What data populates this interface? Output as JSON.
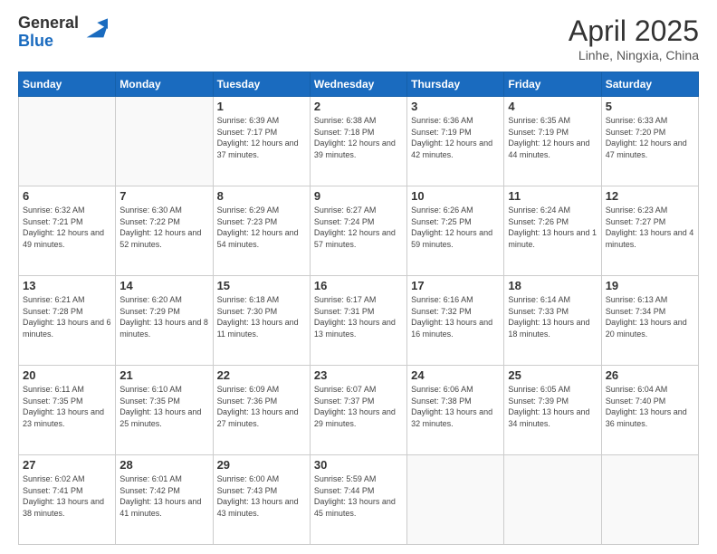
{
  "logo": {
    "general": "General",
    "blue": "Blue"
  },
  "title": "April 2025",
  "subtitle": "Linhe, Ningxia, China",
  "days_of_week": [
    "Sunday",
    "Monday",
    "Tuesday",
    "Wednesday",
    "Thursday",
    "Friday",
    "Saturday"
  ],
  "weeks": [
    [
      {
        "day": null
      },
      {
        "day": null
      },
      {
        "day": "1",
        "sunrise": "Sunrise: 6:39 AM",
        "sunset": "Sunset: 7:17 PM",
        "daylight": "Daylight: 12 hours and 37 minutes."
      },
      {
        "day": "2",
        "sunrise": "Sunrise: 6:38 AM",
        "sunset": "Sunset: 7:18 PM",
        "daylight": "Daylight: 12 hours and 39 minutes."
      },
      {
        "day": "3",
        "sunrise": "Sunrise: 6:36 AM",
        "sunset": "Sunset: 7:19 PM",
        "daylight": "Daylight: 12 hours and 42 minutes."
      },
      {
        "day": "4",
        "sunrise": "Sunrise: 6:35 AM",
        "sunset": "Sunset: 7:19 PM",
        "daylight": "Daylight: 12 hours and 44 minutes."
      },
      {
        "day": "5",
        "sunrise": "Sunrise: 6:33 AM",
        "sunset": "Sunset: 7:20 PM",
        "daylight": "Daylight: 12 hours and 47 minutes."
      }
    ],
    [
      {
        "day": "6",
        "sunrise": "Sunrise: 6:32 AM",
        "sunset": "Sunset: 7:21 PM",
        "daylight": "Daylight: 12 hours and 49 minutes."
      },
      {
        "day": "7",
        "sunrise": "Sunrise: 6:30 AM",
        "sunset": "Sunset: 7:22 PM",
        "daylight": "Daylight: 12 hours and 52 minutes."
      },
      {
        "day": "8",
        "sunrise": "Sunrise: 6:29 AM",
        "sunset": "Sunset: 7:23 PM",
        "daylight": "Daylight: 12 hours and 54 minutes."
      },
      {
        "day": "9",
        "sunrise": "Sunrise: 6:27 AM",
        "sunset": "Sunset: 7:24 PM",
        "daylight": "Daylight: 12 hours and 57 minutes."
      },
      {
        "day": "10",
        "sunrise": "Sunrise: 6:26 AM",
        "sunset": "Sunset: 7:25 PM",
        "daylight": "Daylight: 12 hours and 59 minutes."
      },
      {
        "day": "11",
        "sunrise": "Sunrise: 6:24 AM",
        "sunset": "Sunset: 7:26 PM",
        "daylight": "Daylight: 13 hours and 1 minute."
      },
      {
        "day": "12",
        "sunrise": "Sunrise: 6:23 AM",
        "sunset": "Sunset: 7:27 PM",
        "daylight": "Daylight: 13 hours and 4 minutes."
      }
    ],
    [
      {
        "day": "13",
        "sunrise": "Sunrise: 6:21 AM",
        "sunset": "Sunset: 7:28 PM",
        "daylight": "Daylight: 13 hours and 6 minutes."
      },
      {
        "day": "14",
        "sunrise": "Sunrise: 6:20 AM",
        "sunset": "Sunset: 7:29 PM",
        "daylight": "Daylight: 13 hours and 8 minutes."
      },
      {
        "day": "15",
        "sunrise": "Sunrise: 6:18 AM",
        "sunset": "Sunset: 7:30 PM",
        "daylight": "Daylight: 13 hours and 11 minutes."
      },
      {
        "day": "16",
        "sunrise": "Sunrise: 6:17 AM",
        "sunset": "Sunset: 7:31 PM",
        "daylight": "Daylight: 13 hours and 13 minutes."
      },
      {
        "day": "17",
        "sunrise": "Sunrise: 6:16 AM",
        "sunset": "Sunset: 7:32 PM",
        "daylight": "Daylight: 13 hours and 16 minutes."
      },
      {
        "day": "18",
        "sunrise": "Sunrise: 6:14 AM",
        "sunset": "Sunset: 7:33 PM",
        "daylight": "Daylight: 13 hours and 18 minutes."
      },
      {
        "day": "19",
        "sunrise": "Sunrise: 6:13 AM",
        "sunset": "Sunset: 7:34 PM",
        "daylight": "Daylight: 13 hours and 20 minutes."
      }
    ],
    [
      {
        "day": "20",
        "sunrise": "Sunrise: 6:11 AM",
        "sunset": "Sunset: 7:35 PM",
        "daylight": "Daylight: 13 hours and 23 minutes."
      },
      {
        "day": "21",
        "sunrise": "Sunrise: 6:10 AM",
        "sunset": "Sunset: 7:35 PM",
        "daylight": "Daylight: 13 hours and 25 minutes."
      },
      {
        "day": "22",
        "sunrise": "Sunrise: 6:09 AM",
        "sunset": "Sunset: 7:36 PM",
        "daylight": "Daylight: 13 hours and 27 minutes."
      },
      {
        "day": "23",
        "sunrise": "Sunrise: 6:07 AM",
        "sunset": "Sunset: 7:37 PM",
        "daylight": "Daylight: 13 hours and 29 minutes."
      },
      {
        "day": "24",
        "sunrise": "Sunrise: 6:06 AM",
        "sunset": "Sunset: 7:38 PM",
        "daylight": "Daylight: 13 hours and 32 minutes."
      },
      {
        "day": "25",
        "sunrise": "Sunrise: 6:05 AM",
        "sunset": "Sunset: 7:39 PM",
        "daylight": "Daylight: 13 hours and 34 minutes."
      },
      {
        "day": "26",
        "sunrise": "Sunrise: 6:04 AM",
        "sunset": "Sunset: 7:40 PM",
        "daylight": "Daylight: 13 hours and 36 minutes."
      }
    ],
    [
      {
        "day": "27",
        "sunrise": "Sunrise: 6:02 AM",
        "sunset": "Sunset: 7:41 PM",
        "daylight": "Daylight: 13 hours and 38 minutes."
      },
      {
        "day": "28",
        "sunrise": "Sunrise: 6:01 AM",
        "sunset": "Sunset: 7:42 PM",
        "daylight": "Daylight: 13 hours and 41 minutes."
      },
      {
        "day": "29",
        "sunrise": "Sunrise: 6:00 AM",
        "sunset": "Sunset: 7:43 PM",
        "daylight": "Daylight: 13 hours and 43 minutes."
      },
      {
        "day": "30",
        "sunrise": "Sunrise: 5:59 AM",
        "sunset": "Sunset: 7:44 PM",
        "daylight": "Daylight: 13 hours and 45 minutes."
      },
      {
        "day": null
      },
      {
        "day": null
      },
      {
        "day": null
      }
    ]
  ]
}
